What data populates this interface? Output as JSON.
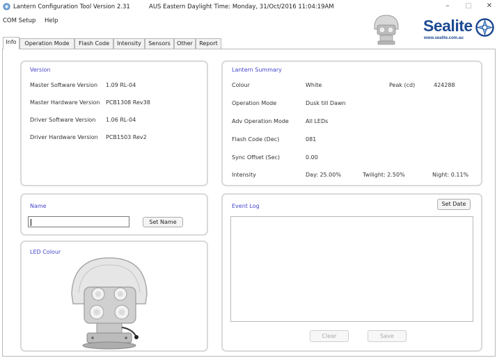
{
  "window": {
    "title": "Lantern Configuration Tool Version 2.31",
    "time_label": "AUS Eastern Daylight Time: Monday, 31/Oct/2016 11:04:19AM",
    "minimize": "–",
    "maximize": "□",
    "close": "✕"
  },
  "menu": [
    {
      "label": "COM Setup"
    },
    {
      "label": "Help"
    }
  ],
  "logo": {
    "brand": "Sealite",
    "url": "www.sealite.com.au",
    "brand_color": "#1d4a93"
  },
  "tabs": [
    {
      "label": "Info",
      "active": true
    },
    {
      "label": "Operation Mode"
    },
    {
      "label": "Flash Code"
    },
    {
      "label": "Intensity"
    },
    {
      "label": "Sensors"
    },
    {
      "label": "Other"
    },
    {
      "label": "Report"
    }
  ],
  "version": {
    "title": "Version",
    "rows": [
      {
        "label": "Master Software Version",
        "value": "1.09 RL-04"
      },
      {
        "label": "Master Hardware Version",
        "value": "PCB1308 Rev38"
      },
      {
        "label": "Driver Software Version",
        "value": "1.06 RL-04"
      },
      {
        "label": "Driver Hardware Version",
        "value": "PCB1503 Rev2"
      }
    ]
  },
  "summary": {
    "title": "Lantern Summary",
    "colour_label": "Colour",
    "colour_value": "White",
    "peak_label": "Peak (cd)",
    "peak_value": "424288",
    "operation_mode_label": "Operation Mode",
    "operation_mode_value": "Dusk till Dawn",
    "adv_mode_label": "Adv Operation Mode",
    "adv_mode_value": "All LEDs",
    "flash_code_label": "Flash Code (Dec)",
    "flash_code_value": "081",
    "sync_offset_label": "Sync Offset (Sec)",
    "sync_offset_value": "0.00",
    "intensity_label": "Intensity",
    "intensity_day": "Day: 25.00%",
    "intensity_twilight": "Twilight: 2.50%",
    "intensity_night": "Night: 0.11%"
  },
  "name_panel": {
    "title": "Name",
    "input_value": "",
    "set_name_label": "Set Name"
  },
  "led_panel": {
    "title": "LED Colour"
  },
  "event_log": {
    "title": "Event Log",
    "set_date_label": "Set Date",
    "clear_label": "Clear",
    "save_label": "Save"
  },
  "colors": {
    "panel_title": "#4444cc",
    "panel_border": "#d9d9d9"
  },
  "icons": {
    "app": "lantern-app-icon",
    "logo_mark": "sealite-swirl-icon"
  }
}
